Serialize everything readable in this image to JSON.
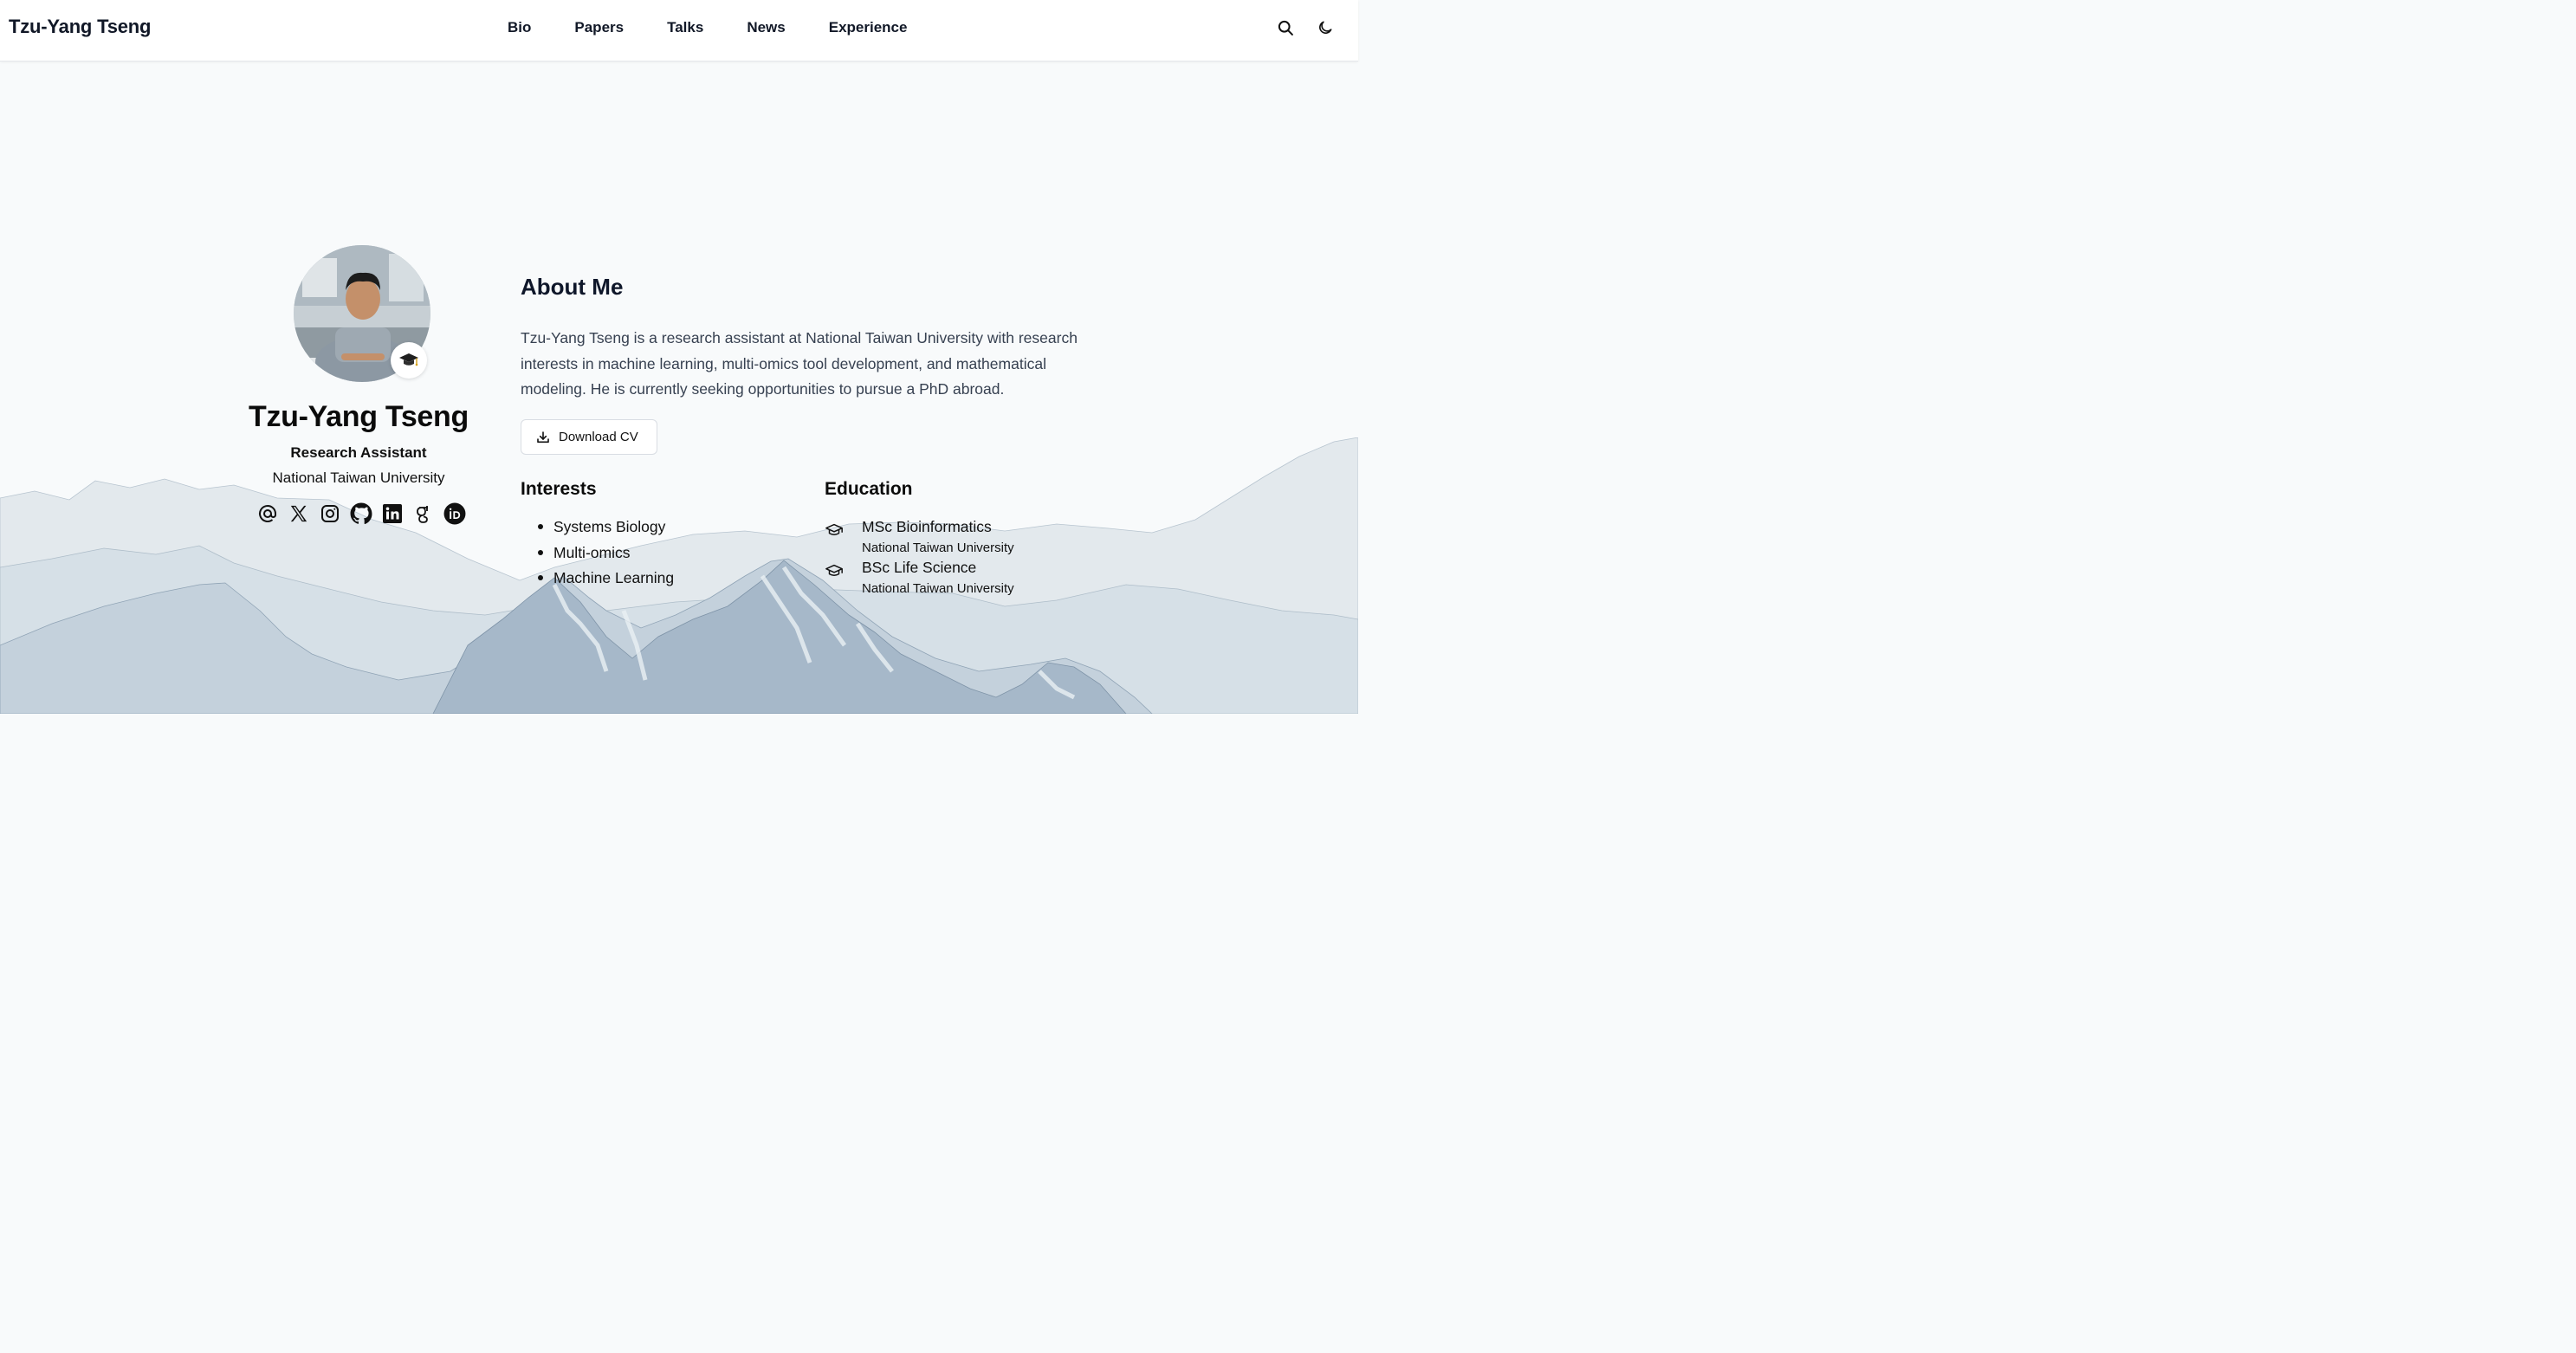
{
  "nav": {
    "brand": "Tzu-Yang Tseng",
    "links": [
      "Bio",
      "Papers",
      "Talks",
      "News",
      "Experience"
    ],
    "search_icon": "search-icon",
    "theme_icon": "moon-icon"
  },
  "profile": {
    "name": "Tzu-Yang Tseng",
    "role": "Research Assistant",
    "organization": "National Taiwan University",
    "badge_icon": "graduation-cap-emoji",
    "socials": [
      "email-icon",
      "x-icon",
      "instagram-icon",
      "github-icon",
      "linkedin-icon",
      "google-scholar-icon",
      "orcid-icon"
    ]
  },
  "about": {
    "title": "About Me",
    "text": "Tzu-Yang Tseng is a research assistant at National Taiwan University with research interests in machine learning, multi-omics tool development, and mathematical modeling. He is currently seeking opportunities to pursue a PhD abroad.",
    "cv_label": "Download CV"
  },
  "interests": {
    "title": "Interests",
    "items": [
      "Systems Biology",
      "Multi-omics",
      "Machine Learning"
    ]
  },
  "education": {
    "title": "Education",
    "items": [
      {
        "degree": "MSc Bioinformatics",
        "institution": "National Taiwan University"
      },
      {
        "degree": "BSc Life Science",
        "institution": "National Taiwan University"
      }
    ]
  },
  "colors": {
    "mountain_light": "#e3e9ed",
    "mountain_mid": "#c9d5de",
    "mountain_dark": "#a6b8c9",
    "heading": "#0f172a",
    "body_text": "#374151"
  }
}
